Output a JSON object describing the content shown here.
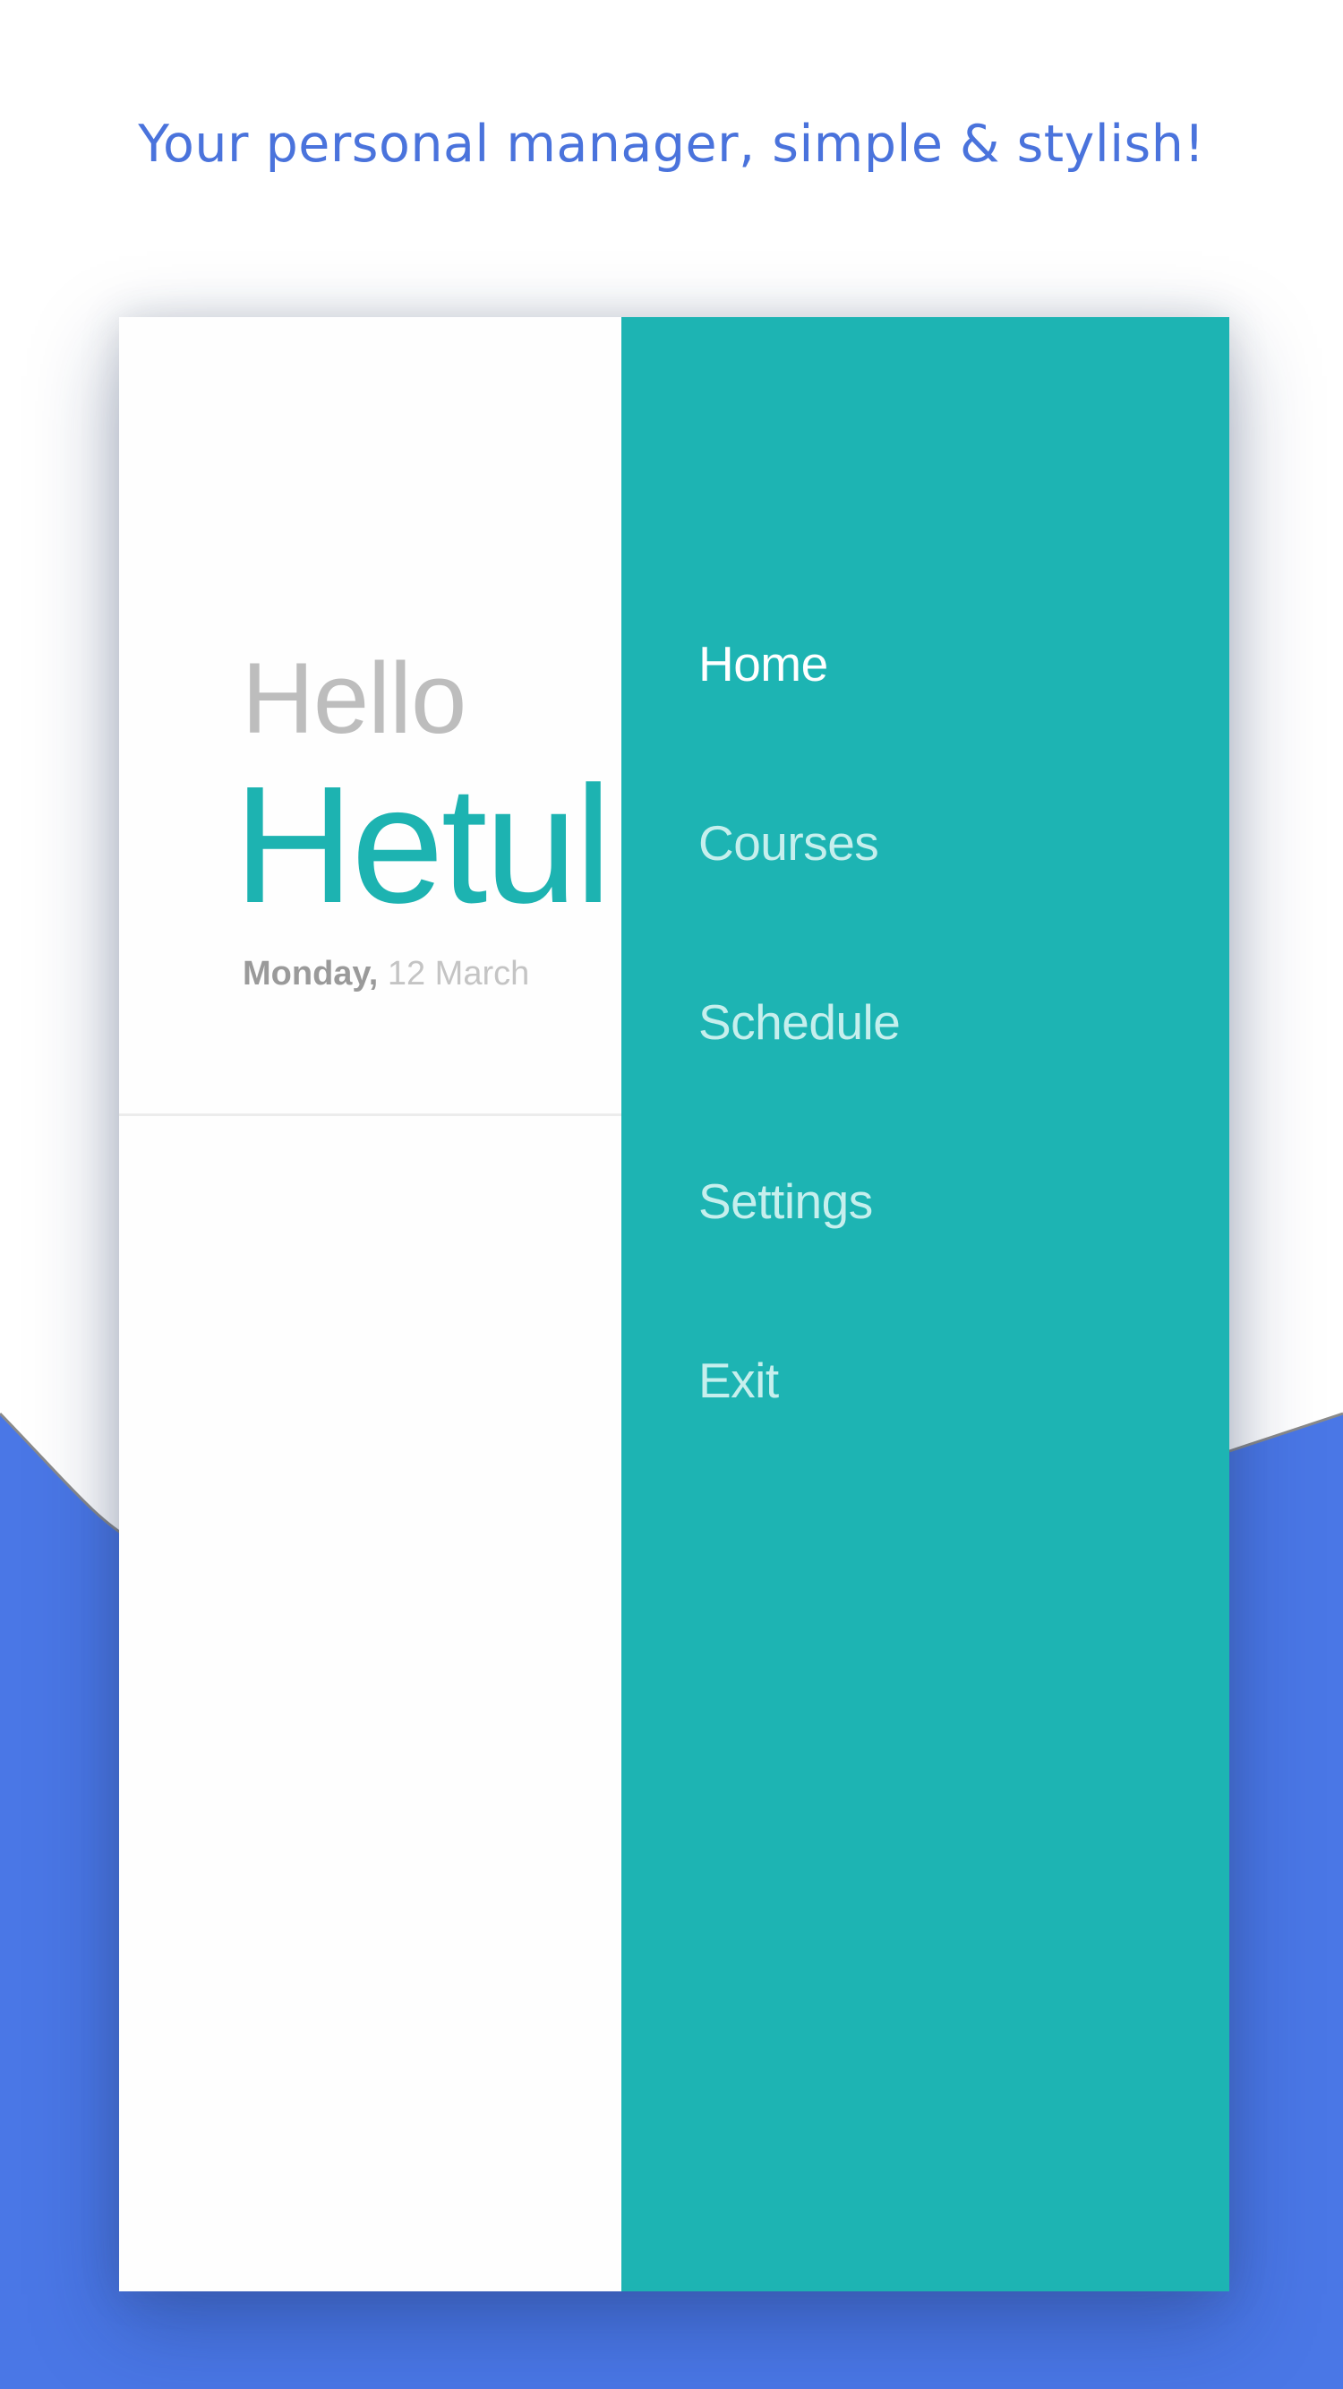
{
  "tagline": "Your personal manager, simple & stylish!",
  "greeting": {
    "hello": "Hello",
    "name": "Hetul",
    "day": "Monday,",
    "date": " 12 March"
  },
  "menu": {
    "items": [
      {
        "label": "Home",
        "active": true
      },
      {
        "label": "Courses",
        "active": false
      },
      {
        "label": "Schedule",
        "active": false
      },
      {
        "label": "Settings",
        "active": false
      },
      {
        "label": "Exit",
        "active": false
      }
    ]
  },
  "colors": {
    "accent_blue": "#4a73dc",
    "teal": "#1db4b3",
    "greeting_grey": "#bdbdbd"
  }
}
